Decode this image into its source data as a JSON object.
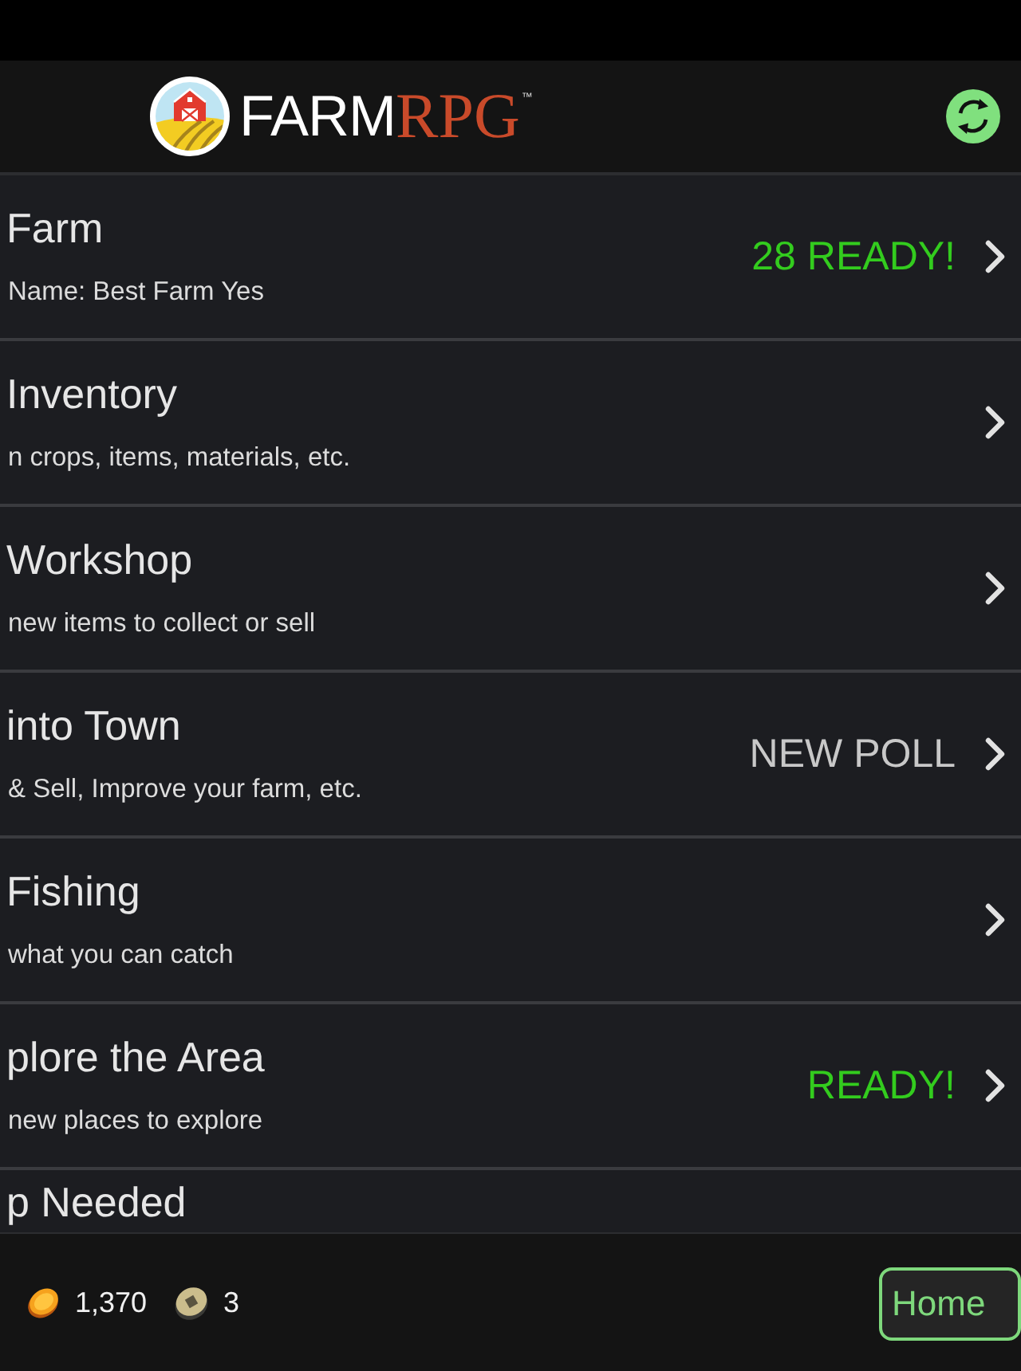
{
  "header": {
    "logo": {
      "text": "FARM",
      "accent_text": "RPG",
      "mark": "™"
    }
  },
  "menu": [
    {
      "title": "Farm",
      "subtitle": "Name: Best Farm Yes",
      "status": {
        "text": "28 READY!",
        "color": "#33cc1e"
      },
      "chevron": true
    },
    {
      "title": "Inventory",
      "subtitle": "n crops, items, materials, etc.",
      "chevron": true
    },
    {
      "title": "Workshop",
      "subtitle": "new items to collect or sell",
      "chevron": true
    },
    {
      "title": "into Town",
      "subtitle": "& Sell, Improve your farm, etc.",
      "status": {
        "text": "NEW POLL",
        "color": "#c8c8c8"
      },
      "chevron": true
    },
    {
      "title": "Fishing",
      "subtitle": "what you can catch",
      "chevron": true
    },
    {
      "title": "plore the Area",
      "subtitle": "new places to explore",
      "status": {
        "text": "READY!",
        "color": "#33cc1e"
      },
      "chevron": true
    },
    {
      "title": "p Needed",
      "chevron": false
    }
  ],
  "footer": {
    "currencies": [
      {
        "kind": "gold",
        "amount": "1,370"
      },
      {
        "kind": "ancient",
        "amount": "3"
      }
    ],
    "home_button": {
      "label": "Home"
    }
  }
}
